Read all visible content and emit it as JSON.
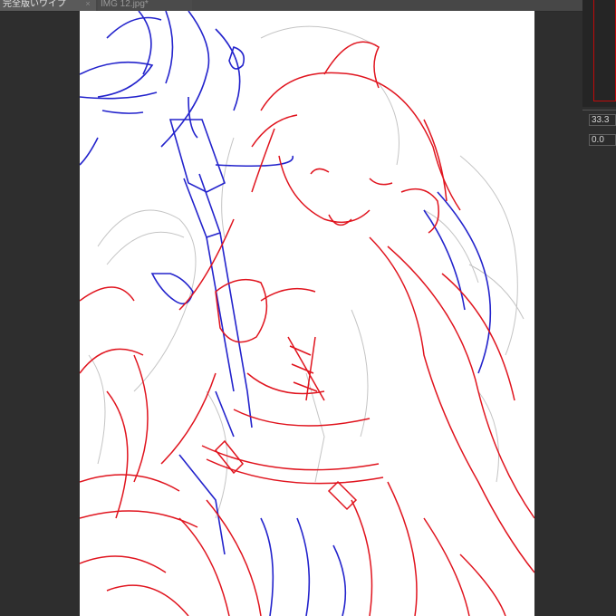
{
  "tabs": [
    {
      "label": "完全版いワイプ",
      "close_glyph": "×",
      "active": true
    },
    {
      "label": "IMG 12.jpg*",
      "active": false
    }
  ],
  "navigator": {
    "zoom_value": "33.3",
    "rotation_value": "0.0",
    "frame_color": "#c00a0a"
  },
  "canvas": {
    "background": "#ffffff",
    "line_colors": {
      "red": "#e0141e",
      "blue": "#2323cc",
      "sketch": "#b8b8b8"
    }
  },
  "icons": {
    "tab_close": "close-icon",
    "tab_modified": "modified-dot-icon"
  }
}
